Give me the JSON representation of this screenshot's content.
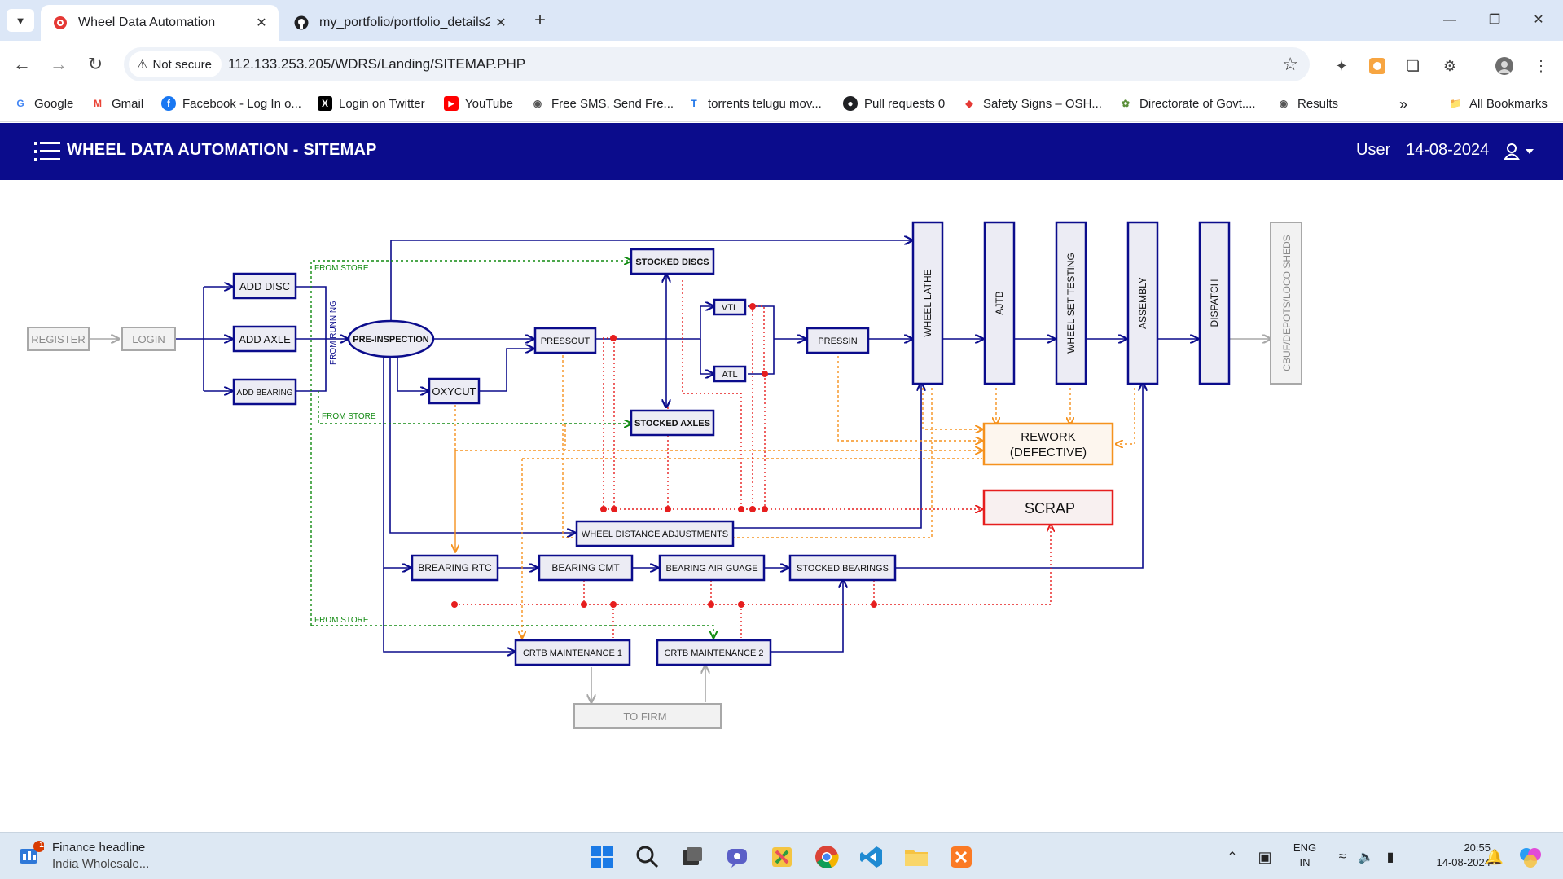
{
  "browser": {
    "tabs": [
      {
        "title": "Wheel Data Automation",
        "active": true
      },
      {
        "title": "my_portfolio/portfolio_details2.",
        "active": false
      }
    ],
    "security_label": "Not secure",
    "url": "112.133.253.205/WDRS/Landing/SITEMAP.PHP",
    "bookmarks": [
      {
        "label": "Google",
        "icon": "google-icon"
      },
      {
        "label": "Gmail",
        "icon": "gmail-icon"
      },
      {
        "label": "Facebook - Log In o...",
        "icon": "facebook-icon"
      },
      {
        "label": "Login on Twitter",
        "icon": "x-icon"
      },
      {
        "label": "YouTube",
        "icon": "youtube-icon"
      },
      {
        "label": "Free SMS, Send Fre...",
        "icon": "globe-icon"
      },
      {
        "label": "torrents telugu mov...",
        "icon": "t-icon"
      },
      {
        "label": "Pull requests 0",
        "icon": "github-icon"
      },
      {
        "label": "Safety Signs – OSH...",
        "icon": "safety-icon"
      },
      {
        "label": "Directorate of Govt....",
        "icon": "gov-icon"
      },
      {
        "label": "Results",
        "icon": "globe-icon"
      }
    ],
    "all_bookmarks": "All Bookmarks"
  },
  "app": {
    "title": "WHEEL DATA AUTOMATION - SITEMAP",
    "user": "User",
    "date": "14-08-2024"
  },
  "sitemap": {
    "register": "REGISTER",
    "login": "LOGIN",
    "add_disc": "ADD DISC",
    "add_axle": "ADD AXLE",
    "add_bearing": "ADD BEARING",
    "from_store": "FROM STORE",
    "from_running": "FROM RUNNING",
    "pre_inspection": "PRE-INSPECTION",
    "oxycut": "OXYCUT",
    "pressout": "PRESSOUT",
    "stocked_discs": "STOCKED DISCS",
    "stocked_axles": "STOCKED AXLES",
    "vtl": "VTL",
    "atl": "ATL",
    "pressin": "PRESSIN",
    "wheel_lathe": "WHEEL LATHE",
    "ajtb": "AJTB",
    "wheel_set_testing": "WHEEL SET TESTING",
    "assembly": "ASSEMBLY",
    "dispatch": "DISPATCH",
    "cbuf": "CBUF/DEPOTS/LOCO SHEDS",
    "rework_line1": "REWORK",
    "rework_line2": "(DEFECTIVE)",
    "scrap": "SCRAP",
    "wheel_distance": "WHEEL DISTANCE ADJUSTMENTS",
    "bearing_rtc": "BREARING RTC",
    "bearing_cmt": "BEARING CMT",
    "bearing_air": "BEARING AIR GUAGE",
    "stocked_bearings": "STOCKED BEARINGS",
    "crtb1": "CRTB MAINTENANCE 1",
    "crtb2": "CRTB MAINTENANCE 2",
    "to_firm": "TO FIRM",
    "colors": {
      "navy": "#0b0c8c",
      "green": "#118a11",
      "orange": "#f5921e",
      "red": "#e61e1e",
      "grey": "#a8a8a8"
    }
  },
  "taskbar": {
    "widget_title": "Finance headline",
    "widget_sub": "India Wholesale...",
    "widget_badge": "1",
    "lang1": "ENG",
    "lang2": "IN",
    "time": "20:55",
    "date": "14-08-2024"
  }
}
